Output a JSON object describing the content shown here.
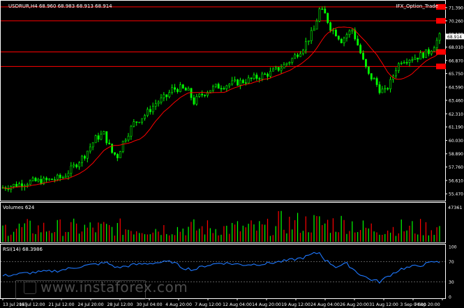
{
  "chart_data": [
    {
      "type": "candlestick",
      "symbol_header": "USDRUR,H4  68.960 68.983 68.913 68.914",
      "indicator_name": "IFX_Option_Trade",
      "current_price_label": "68.914",
      "yticks": [
        "71.390",
        "70.260",
        "69.130",
        "68.914",
        "68.010",
        "66.870",
        "65.750",
        "64.590",
        "63.460",
        "62.310",
        "61.190",
        "60.030",
        "58.890",
        "57.760",
        "56.610",
        "55.470"
      ],
      "ylim": [
        55.0,
        71.8
      ],
      "levels": [
        {
          "value": 70.26,
          "label": "70.260",
          "color": "#ff0000"
        },
        {
          "value": 67.6,
          "label": "67.600",
          "color": "#ff0000"
        },
        {
          "value": 66.36,
          "label": "66.360",
          "color": "#ff0000"
        },
        {
          "value": 71.45,
          "label": "71.450",
          "color": "#ff0000"
        }
      ],
      "price_path_anchors": [
        [
          0,
          56.0
        ],
        [
          4,
          56.2
        ],
        [
          10,
          56.5
        ],
        [
          16,
          56.6
        ],
        [
          22,
          56.9
        ],
        [
          26,
          57.8
        ],
        [
          30,
          58.8
        ],
        [
          34,
          60.2
        ],
        [
          37,
          60.6
        ],
        [
          40,
          59.0
        ],
        [
          42,
          58.7
        ],
        [
          44,
          59.9
        ],
        [
          48,
          61.5
        ],
        [
          52,
          62.2
        ],
        [
          56,
          63.2
        ],
        [
          60,
          63.8
        ],
        [
          62,
          64.4
        ],
        [
          65,
          64.5
        ],
        [
          68,
          64.2
        ],
        [
          70,
          63.3
        ],
        [
          72,
          63.8
        ],
        [
          75,
          64.3
        ],
        [
          78,
          64.6
        ],
        [
          82,
          64.8
        ],
        [
          86,
          65.0
        ],
        [
          90,
          65.2
        ],
        [
          94,
          65.5
        ],
        [
          98,
          65.8
        ],
        [
          102,
          66.3
        ],
        [
          106,
          67.0
        ],
        [
          110,
          68.0
        ],
        [
          114,
          69.5
        ],
        [
          116,
          71.2
        ],
        [
          118,
          70.8
        ],
        [
          120,
          69.7
        ],
        [
          122,
          69.2
        ],
        [
          124,
          68.6
        ],
        [
          126,
          69.1
        ],
        [
          128,
          69.5
        ],
        [
          130,
          68.2
        ],
        [
          132,
          66.8
        ],
        [
          134,
          65.6
        ],
        [
          136,
          65.2
        ],
        [
          138,
          64.4
        ],
        [
          140,
          64.2
        ],
        [
          142,
          65.0
        ],
        [
          144,
          66.2
        ],
        [
          146,
          66.9
        ],
        [
          148,
          67.0
        ],
        [
          152,
          67.2
        ],
        [
          156,
          67.6
        ],
        [
          158,
          68.2
        ],
        [
          160,
          68.9
        ]
      ],
      "series": [
        {
          "name": "price",
          "color": "#00ff00"
        },
        {
          "name": "ma",
          "color": "#ff0000"
        }
      ]
    },
    {
      "type": "bar",
      "title": "Volumes 624",
      "max_label": "47361",
      "ylim": [
        0,
        47361
      ],
      "series": [
        {
          "name": "volume",
          "colors": [
            "#00ff00",
            "#ff0000"
          ]
        }
      ]
    },
    {
      "type": "line",
      "title": "RSI(14) 68.3986",
      "yticks": [
        "100",
        "70",
        "30",
        "0"
      ],
      "ylim": [
        0,
        100
      ],
      "rsi_anchors": [
        [
          0,
          42
        ],
        [
          10,
          48
        ],
        [
          20,
          52
        ],
        [
          30,
          62
        ],
        [
          38,
          68
        ],
        [
          42,
          58
        ],
        [
          48,
          64
        ],
        [
          56,
          68
        ],
        [
          62,
          70
        ],
        [
          66,
          58
        ],
        [
          70,
          54
        ],
        [
          74,
          62
        ],
        [
          80,
          68
        ],
        [
          88,
          64
        ],
        [
          96,
          66
        ],
        [
          104,
          72
        ],
        [
          110,
          78
        ],
        [
          114,
          86
        ],
        [
          116,
          88
        ],
        [
          118,
          74
        ],
        [
          122,
          60
        ],
        [
          126,
          66
        ],
        [
          130,
          48
        ],
        [
          134,
          36
        ],
        [
          138,
          30
        ],
        [
          142,
          44
        ],
        [
          146,
          56
        ],
        [
          150,
          60
        ],
        [
          154,
          64
        ],
        [
          158,
          70
        ],
        [
          160,
          68
        ]
      ],
      "series": [
        {
          "name": "RSI",
          "color": "#1e78ff"
        }
      ]
    }
  ],
  "x_axis": {
    "labels": [
      "13 Jul 2015",
      "16 Jul 12:00",
      "21 Jul 12:00",
      "24 Jul 20:00",
      "28 Jul 12:00",
      "30 Jul 04:00",
      "4 Aug 20:00",
      "7 Aug 12:00",
      "12 Aug 04:00",
      "14 Aug 20:00",
      "19 Aug 12:00",
      "24 Aug 04:00",
      "26 Aug 20:00",
      "31 Aug 12:00",
      "3 Sep 04:00",
      "7 Sep 20:00"
    ]
  },
  "watermark": {
    "brand": "instaforex",
    "domain_text": "www.instaforex.com"
  },
  "colors": {
    "background": "#000000",
    "up": "#00ff00",
    "down": "#00ff00",
    "ma": "#ff0000",
    "level": "#ff0000",
    "rsi": "#1e78ff",
    "axis": "#ffffff"
  }
}
